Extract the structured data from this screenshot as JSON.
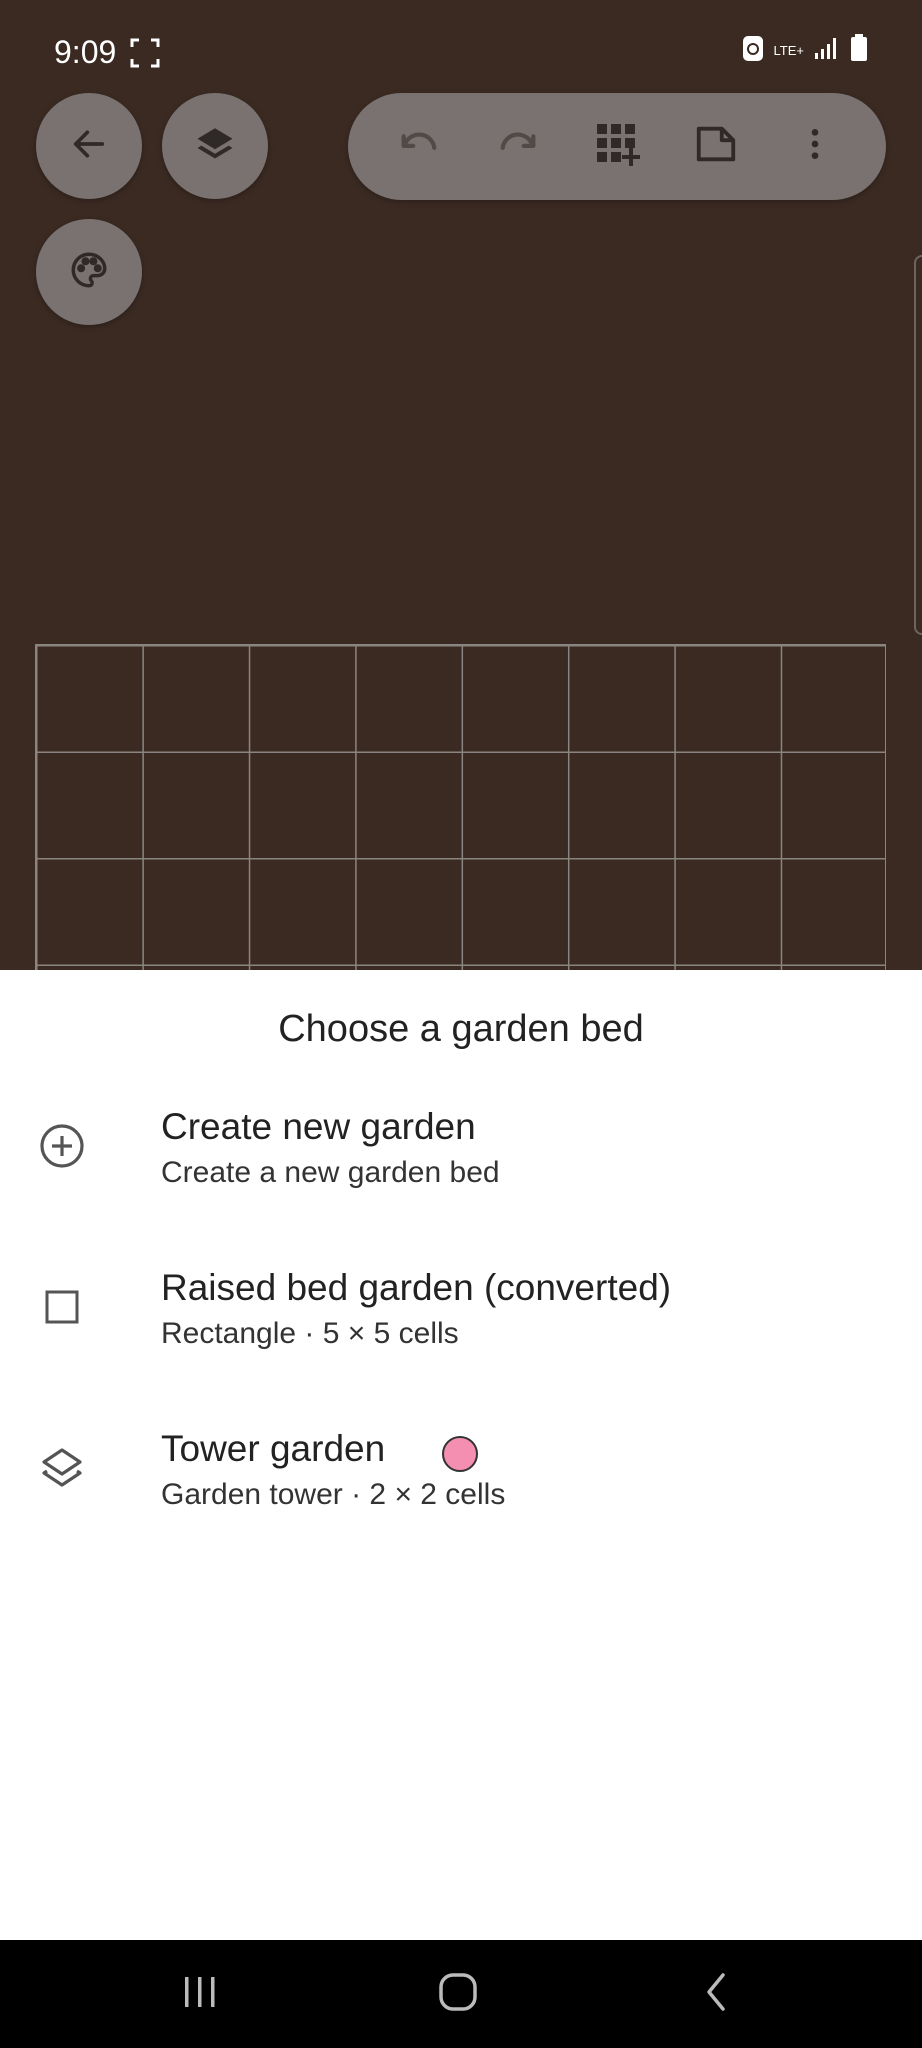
{
  "status_bar": {
    "time": "9:09",
    "network": "LTE+"
  },
  "canvas": {
    "background_color": "#3a2a22",
    "grid_columns": 8,
    "grid_rows_visible": 3
  },
  "fabs": {
    "back": "arrow-left-icon",
    "layers": "layers-icon",
    "palette": "palette-icon"
  },
  "toolbar": {
    "undo": "undo-icon",
    "redo": "redo-icon",
    "add_grid": "grid-add-icon",
    "page": "page-icon",
    "more": "more-vert-icon"
  },
  "sheet": {
    "title": "Choose a garden bed",
    "options": [
      {
        "icon": "add-circle-icon",
        "title": "Create new garden",
        "subtitle": "Create a new garden bed"
      },
      {
        "icon": "square-icon",
        "title": "Raised bed garden (converted)",
        "subtitle": "Rectangle · 5 × 5 cells"
      },
      {
        "icon": "layers-outline-icon",
        "title": "Tower garden",
        "subtitle": "Garden tower · 2 × 2 cells",
        "color": "#f48fb1"
      }
    ]
  },
  "navbar": {
    "recents": "recents-icon",
    "home": "home-icon",
    "back": "back-chevron-icon"
  }
}
